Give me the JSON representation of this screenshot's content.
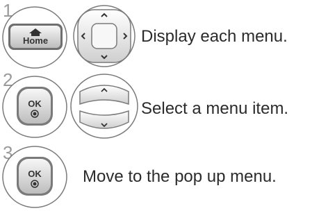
{
  "steps": [
    {
      "number": "1",
      "buttons": [
        {
          "label": "Home",
          "icon": "home-icon"
        },
        {
          "label": "",
          "icon": "four-way-dpad-icon"
        }
      ],
      "text": "Display each menu."
    },
    {
      "number": "2",
      "buttons": [
        {
          "label": "OK",
          "icon": "ok-button-icon"
        },
        {
          "label": "",
          "icon": "up-down-rocker-icon"
        }
      ],
      "text": "Select a menu item."
    },
    {
      "number": "3",
      "buttons": [
        {
          "label": "OK",
          "icon": "ok-button-icon"
        }
      ],
      "text": "Move to the pop up menu."
    }
  ],
  "colors": {
    "frame_stroke": "#7a7a7a",
    "frame_fill_light": "#f4f4f4",
    "frame_fill_dark": "#c8c8c8",
    "text": "#2b2b2b",
    "number": "#9a9a9a"
  }
}
